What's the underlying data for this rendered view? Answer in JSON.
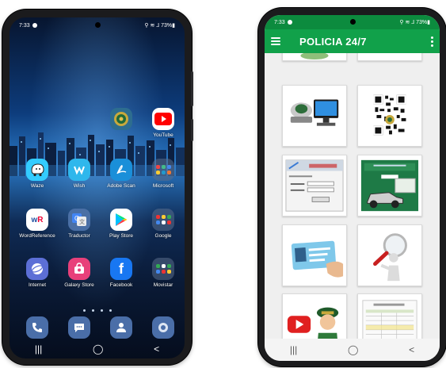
{
  "left_phone": {
    "status_time": "7:33",
    "status_right": "⚲ ≋ ⅃ 73%▮",
    "home_rows": [
      [
        {
          "label": "",
          "icon": "police-emblem-icon",
          "color": "#2d6d8f"
        },
        {
          "label": "YouTube",
          "icon": "youtube-icon",
          "color": "#ffffff"
        }
      ],
      [
        {
          "label": "Waze",
          "icon": "waze-icon",
          "color": "#33ccff"
        },
        {
          "label": "Wish",
          "icon": "wish-icon",
          "color": "#2fb7ec"
        },
        {
          "label": "Adobe Scan",
          "icon": "adobe-scan-icon",
          "color": "#1a8fd9"
        },
        {
          "label": "Microsoft",
          "icon": "folder-icon",
          "color": "#5a6e8c"
        }
      ],
      [
        {
          "label": "WordReference",
          "icon": "wordreference-icon",
          "color": "#ffffff"
        },
        {
          "label": "Traductor",
          "icon": "google-translate-icon",
          "color": "#4a6fa5"
        },
        {
          "label": "Play Store",
          "icon": "play-store-icon",
          "color": "#ffffff"
        },
        {
          "label": "Google",
          "icon": "folder-icon",
          "color": "#5a6e8c"
        }
      ],
      [
        {
          "label": "Internet",
          "icon": "globe-icon",
          "color": "#5c6fd6"
        },
        {
          "label": "Galaxy Store",
          "icon": "galaxy-store-icon",
          "color": "#e8407a"
        },
        {
          "label": "Facebook",
          "icon": "facebook-icon",
          "color": "#1877f2"
        },
        {
          "label": "Movistar",
          "icon": "folder-icon",
          "color": "#5a6e8c"
        }
      ]
    ],
    "dock": [
      {
        "icon": "phone-icon"
      },
      {
        "icon": "messages-icon"
      },
      {
        "icon": "contacts-icon"
      },
      {
        "icon": "camera-icon"
      }
    ],
    "nav": {
      "recents": "|||",
      "home": "◯",
      "back": "<"
    }
  },
  "right_phone": {
    "status_time": "7:33",
    "status_right": "⚲ ≋ ⅃ 73%▮",
    "app_title": "POLICIA 24/7",
    "tiles": [
      {
        "icon": "police-badge-computer-icon"
      },
      {
        "icon": "qr-code-icon"
      },
      {
        "icon": "login-form-icon"
      },
      {
        "icon": "vehicle-query-icon"
      },
      {
        "icon": "id-card-icon"
      },
      {
        "icon": "magnifier-person-icon"
      },
      {
        "icon": "youtube-police-icon"
      },
      {
        "icon": "document-table-icon"
      }
    ],
    "nav": {
      "recents": "|||",
      "home": "◯",
      "back": "<"
    }
  },
  "colors": {
    "app_green": "#11a14a",
    "status_green": "#0c8b3e"
  }
}
